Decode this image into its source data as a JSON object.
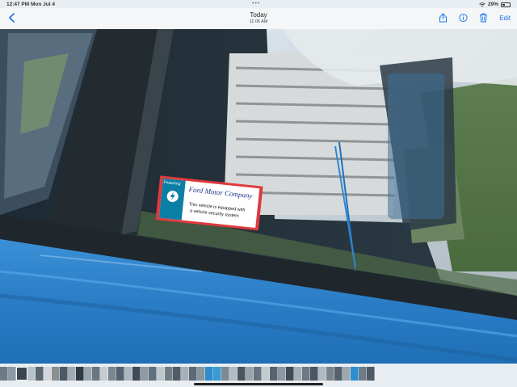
{
  "status_bar": {
    "time": "12:47 PM",
    "date": "Mon Jul 4",
    "multitask_dots": "•••",
    "battery_percent": "29%"
  },
  "nav": {
    "title": "Today",
    "subtitle": "11:06 AM",
    "edit_label": "Edit",
    "accent_color": "#1a73e8",
    "icons": [
      "chevron-left-icon",
      "share-icon",
      "info-icon",
      "trash-icon"
    ]
  },
  "photo": {
    "sticker": {
      "header": "Featuring",
      "brand": "Ford Motor Company",
      "text_line1": "This vehicle is equipped with",
      "text_line2": "a vehicle security system"
    }
  },
  "thumbnails": {
    "count": 46,
    "colors": [
      "#6e7a84",
      "#8e9aa3",
      "#3d4650",
      "#b8c2c9",
      "#5a6770",
      "#d0d6da",
      "#8a8f93",
      "#4b5966",
      "#a1aab0",
      "#2f3a44",
      "#99a5ad",
      "#6a7680",
      "#c6ccd0",
      "#7b8790",
      "#536170",
      "#adb6bc",
      "#3e4a55",
      "#8f9ba4",
      "#607080",
      "#bfc7cc",
      "#707d87",
      "#4f5c68",
      "#a8b1b7",
      "#5d6a75",
      "#8896a0",
      "#2e8dc9",
      "#3a9ad4",
      "#7c8a95",
      "#b3bcc2",
      "#4a5560",
      "#9aa4ab",
      "#667380",
      "#c4cbd0",
      "#57636e",
      "#8c97a0",
      "#3f4b56",
      "#a5afb5",
      "#6c7883",
      "#495561",
      "#b0b9bf",
      "#78848e",
      "#55626d",
      "#9ea8af",
      "#2d8fd0",
      "#6f7b86",
      "#4d5a66"
    ]
  }
}
